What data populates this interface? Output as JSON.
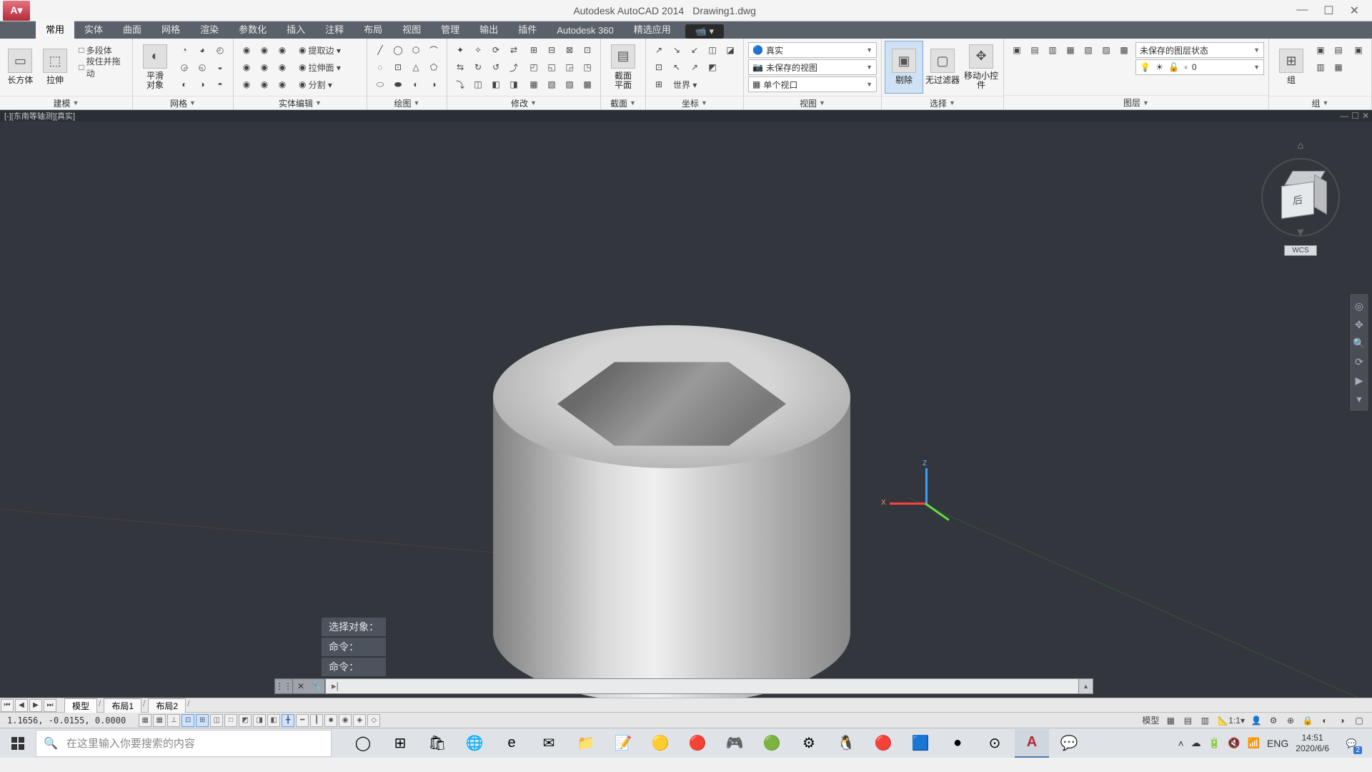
{
  "app": {
    "title": "Autodesk AutoCAD 2014",
    "file": "Drawing1.dwg"
  },
  "menubar": [
    "常用",
    "实体",
    "曲面",
    "网格",
    "渲染",
    "参数化",
    "插入",
    "注释",
    "布局",
    "视图",
    "管理",
    "输出",
    "插件",
    "Autodesk 360",
    "精选应用"
  ],
  "menubar_active": 0,
  "ribbon": {
    "panels": [
      {
        "name": "建模",
        "big": [
          {
            "lbl": "长方体",
            "ico": "▭"
          },
          {
            "lbl": "拉伸",
            "ico": "⬚"
          }
        ],
        "rows": [
          [
            "多段体"
          ],
          [
            "按住并拖动"
          ]
        ]
      },
      {
        "name": "网格",
        "big": [
          {
            "lbl": "平滑\n对象",
            "ico": "◐"
          }
        ],
        "grid": [
          [
            "◔",
            "◕",
            "◴"
          ],
          [
            "◶",
            "◵",
            "◒"
          ],
          [
            "◐",
            "◑",
            "◓"
          ]
        ]
      },
      {
        "name": "实体编辑",
        "rows_wide": [
          [
            "◉",
            "提取边 ▾"
          ],
          [
            "◉",
            "拉伸面 ▾"
          ],
          [
            "◉",
            "分割 ▾"
          ]
        ],
        "grid_prefix": [
          [
            "◉",
            "◉",
            "◉"
          ],
          [
            "◉",
            "◉",
            "◉"
          ],
          [
            "◉",
            "◉",
            "◉"
          ]
        ]
      },
      {
        "name": "绘图",
        "grid": [
          [
            "╱",
            "◯",
            "⬡",
            "⌒"
          ],
          [
            "◌",
            "⊡",
            "△",
            "⬠"
          ],
          [
            "⬭",
            "⬬",
            "◐",
            "◑"
          ]
        ]
      },
      {
        "name": "修改",
        "grid": [
          [
            "✦",
            "✧",
            "⟳",
            "⇄"
          ],
          [
            "⇆",
            "↻",
            "↺",
            "⤴"
          ],
          [
            "⤵",
            "◫",
            "◧",
            "◨"
          ]
        ],
        "grid2": [
          [
            "⊞",
            "⊟",
            "⊠",
            "⊡"
          ],
          [
            "◰",
            "◱",
            "◲",
            "◳"
          ],
          [
            "▦",
            "▧",
            "▨",
            "▩"
          ]
        ]
      },
      {
        "name": "截面",
        "big": [
          {
            "lbl": "截面\n平面",
            "ico": "▤"
          }
        ]
      },
      {
        "name": "坐标",
        "grid": [
          [
            "↗",
            "↘",
            "↙",
            "◫",
            "◪"
          ],
          [
            "⊡",
            "↖",
            "↗",
            "◩"
          ],
          [
            "⊞",
            "世界 ▾"
          ]
        ]
      },
      {
        "name": "视图",
        "dropdowns": [
          {
            "icon": "🔵",
            "text": "真实"
          },
          {
            "icon": "📷",
            "text": "未保存的视图"
          },
          {
            "icon": "▦",
            "text": "单个视口"
          }
        ]
      },
      {
        "name": "选择",
        "big": [
          {
            "lbl": "剔除",
            "ico": "▣",
            "active": true
          },
          {
            "lbl": "无过滤器",
            "ico": "▢"
          },
          {
            "lbl": "移动小控件",
            "ico": "✥"
          }
        ]
      },
      {
        "name": "图层",
        "grid_toprow": [
          "▣",
          "▤",
          "▥",
          "▦",
          "▧",
          "▨",
          "▩"
        ],
        "dropdowns": [
          {
            "text": "未保存的图层状态"
          },
          {
            "prefix": "💡 ☀ 🔓 ▫",
            "text": "0"
          }
        ]
      },
      {
        "name": "组",
        "big": [
          {
            "lbl": "组",
            "ico": "⊞"
          }
        ],
        "grid": [
          [
            "▣",
            "▤"
          ],
          [
            "▥",
            "▦"
          ]
        ],
        "extra": "▣"
      }
    ]
  },
  "viewport_label": "[-][东南等轴测][真实]",
  "viewcube": {
    "face": "后",
    "wcs": "WCS"
  },
  "ucs_labels": {
    "z": "Z",
    "x": "X"
  },
  "cmd_history": [
    "选择对象：",
    "命令：",
    "命令："
  ],
  "cmd_prompt": "▸|",
  "layout_tabs": [
    "模型",
    "布局1",
    "布局2"
  ],
  "layout_active": 0,
  "status": {
    "coords": "1.1656,  -0.0155,  0.0000",
    "toggles": [
      "▦",
      "▦",
      "⊥",
      "⊡",
      "⊞",
      "◫",
      "□",
      "◩",
      "◨",
      "◧",
      "╋",
      "━",
      "┃",
      "■",
      "◉",
      "◈",
      "◇"
    ],
    "toggles_on": [
      3,
      4,
      10
    ],
    "right_text_model": "模型",
    "right_scale": "1:1",
    "right_icons": [
      "▣",
      "▤",
      "▥",
      "⚙",
      "⊕",
      "👤",
      "▾",
      "◐",
      "◑",
      "◒",
      "◓",
      "▤"
    ]
  },
  "taskbar": {
    "search_placeholder": "在这里输入你要搜索的内容",
    "apps": [
      "◯",
      "⊞",
      "🛍",
      "🌐",
      "e",
      "✉",
      "📁",
      "📝",
      "🟡",
      "🔴",
      "🎮",
      "🟢",
      "⚙",
      "🐧",
      "🔴",
      "🟦",
      "●",
      "⊙",
      "A",
      "💬"
    ],
    "active_app_index": 18,
    "tray": [
      "˄",
      "☁",
      "🔋",
      "🔇",
      "📶"
    ],
    "ime": "ENG",
    "clock": {
      "time": "14:51",
      "date": "2020/6/6"
    },
    "notif_count": "2"
  }
}
